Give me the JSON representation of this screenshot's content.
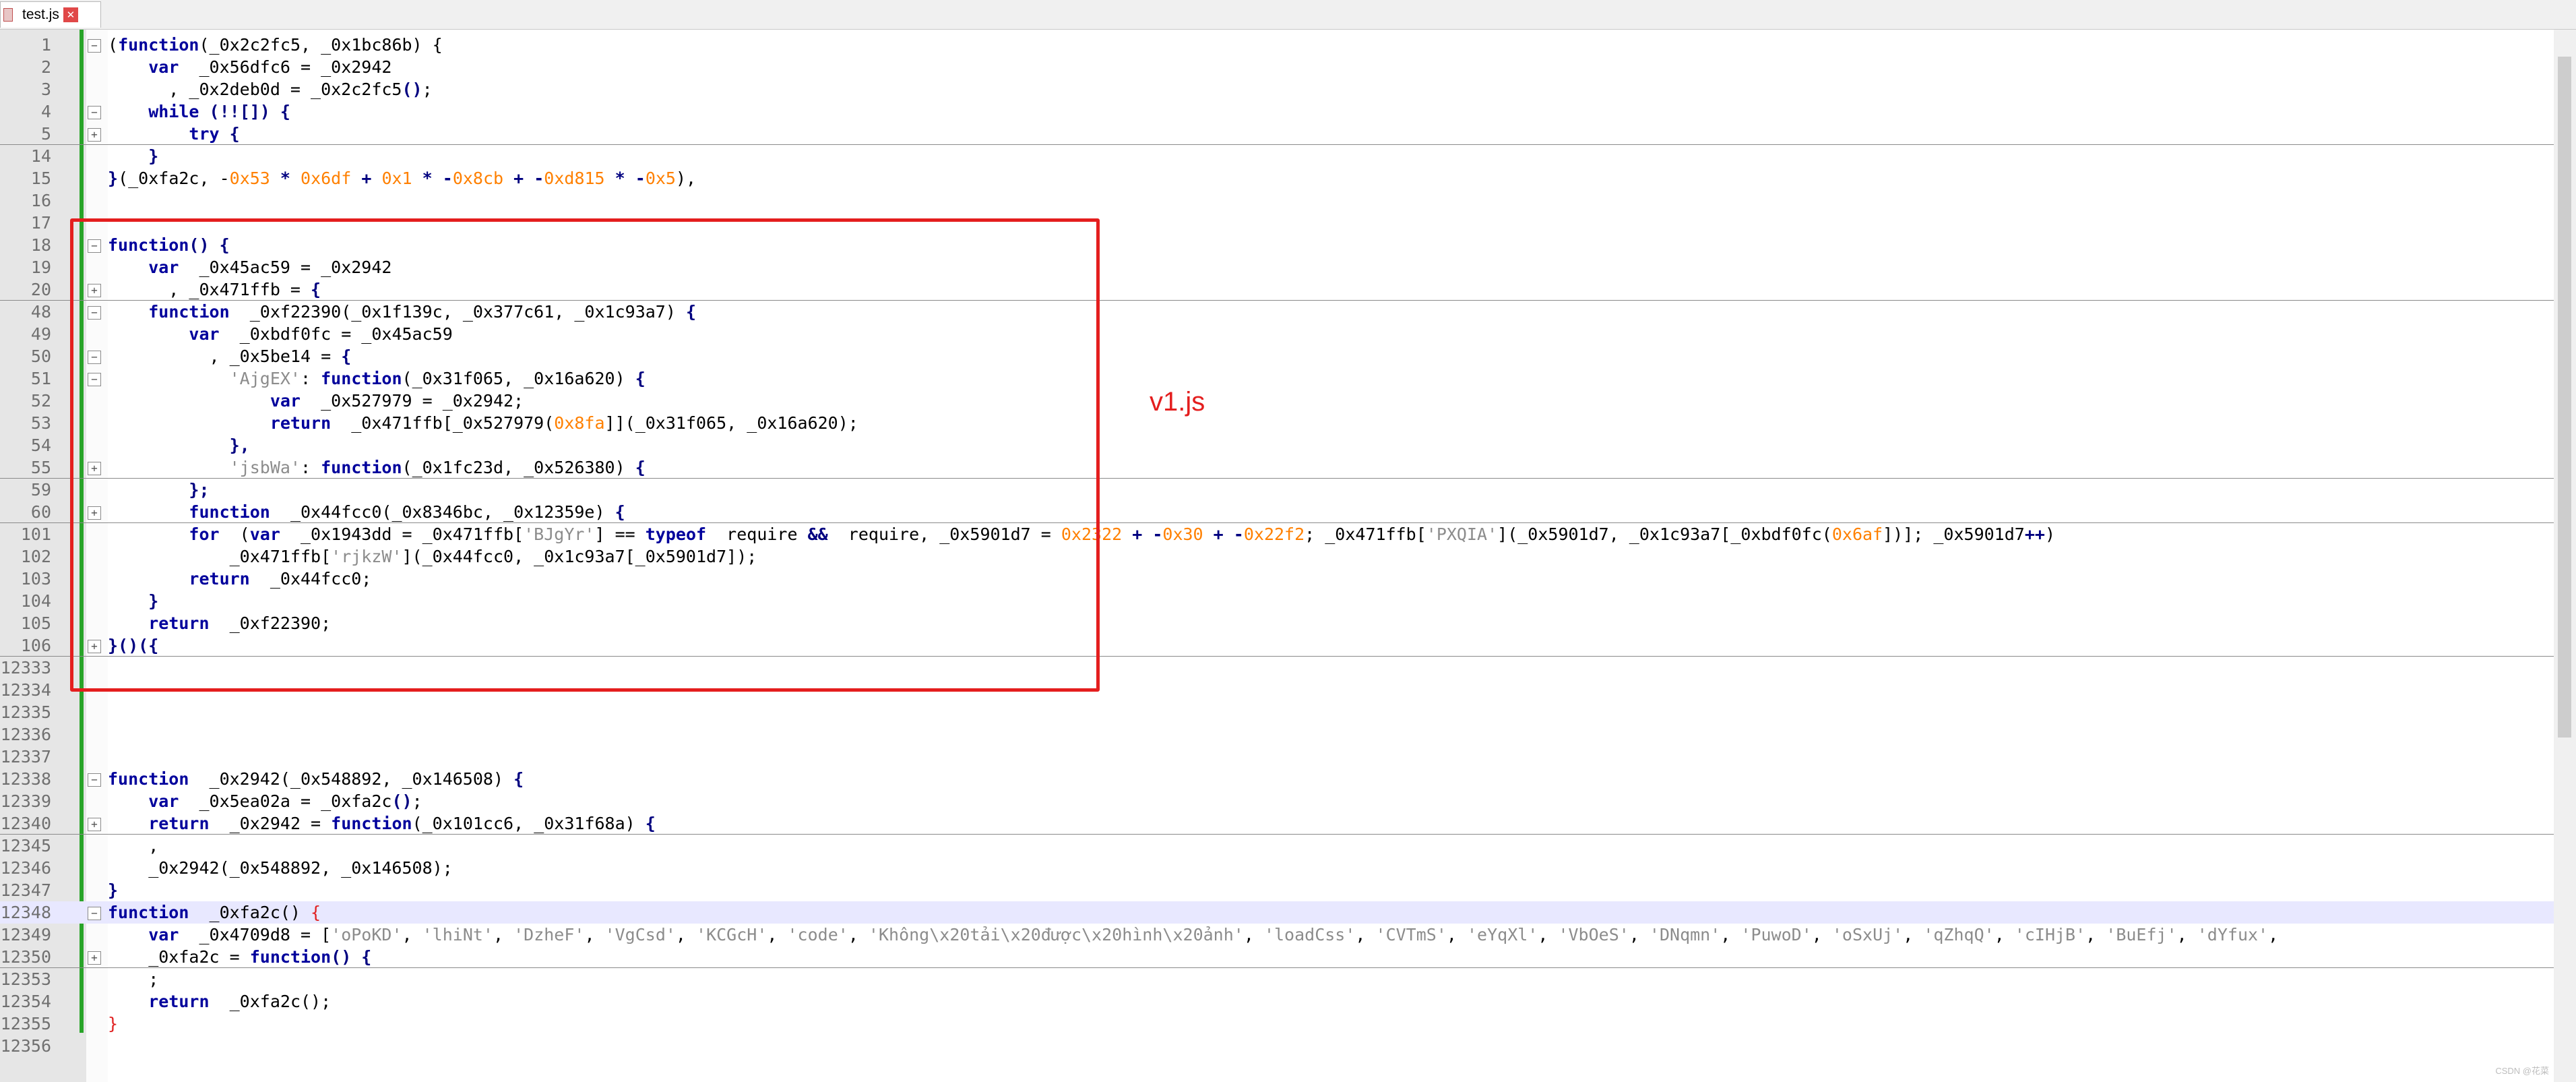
{
  "tab": {
    "filename": "test.js",
    "close_glyph": "✕"
  },
  "annotation": {
    "label": "v1.js",
    "color": "#e41e1e"
  },
  "watermark": "CSDN @花菜",
  "lines": [
    {
      "num": "1",
      "fold": "minus",
      "tokens": [
        [
          "",
          "(",
          ""
        ],
        [
          "kw",
          "function",
          ""
        ],
        [
          "",
          "(_0x2c2fc5, _0x1bc86b) {",
          ""
        ]
      ]
    },
    {
      "num": "2",
      "tokens": [
        [
          "",
          "    ",
          ""
        ],
        [
          "kw",
          "var",
          ""
        ],
        [
          "",
          "  _0x56dfc6 = _0x2942",
          ""
        ]
      ]
    },
    {
      "num": "3",
      "tokens": [
        [
          "",
          "      , _0x2deb0d = _0x2c2fc5",
          ""
        ],
        [
          "op",
          "()",
          ""
        ],
        [
          "",
          ";",
          ""
        ]
      ]
    },
    {
      "num": "4",
      "fold": "minus",
      "tokens": [
        [
          "",
          "    ",
          ""
        ],
        [
          "kw",
          "while",
          ""
        ],
        [
          "op",
          " (!![]) {",
          ""
        ]
      ]
    },
    {
      "num": "5",
      "fold": "plus",
      "sep": true,
      "tokens": [
        [
          "",
          "        ",
          ""
        ],
        [
          "kw",
          "try",
          ""
        ],
        [
          "op",
          " {",
          ""
        ]
      ]
    },
    {
      "num": "14",
      "tokens": [
        [
          "op",
          "    }",
          ""
        ]
      ]
    },
    {
      "num": "15",
      "tokens": [
        [
          "op",
          "}",
          ""
        ],
        [
          "",
          "(_0xfa2c, -",
          ""
        ],
        [
          "num",
          "0x53",
          ""
        ],
        [
          "op",
          " * ",
          ""
        ],
        [
          "num",
          "0x6df",
          ""
        ],
        [
          "op",
          " + ",
          ""
        ],
        [
          "num",
          "0x1",
          ""
        ],
        [
          "op",
          " * -",
          ""
        ],
        [
          "num",
          "0x8cb",
          ""
        ],
        [
          "op",
          " + -",
          ""
        ],
        [
          "num",
          "0xd815",
          ""
        ],
        [
          "op",
          " * -",
          ""
        ],
        [
          "num",
          "0x5",
          ""
        ],
        [
          "",
          "),",
          ""
        ]
      ]
    },
    {
      "num": "16",
      "tokens": []
    },
    {
      "num": "17",
      "tokens": []
    },
    {
      "num": "18",
      "fold": "minus",
      "tokens": [
        [
          "kw",
          "function",
          ""
        ],
        [
          "op",
          "() {",
          ""
        ]
      ]
    },
    {
      "num": "19",
      "tokens": [
        [
          "",
          "    ",
          ""
        ],
        [
          "kw",
          "var",
          ""
        ],
        [
          "",
          "  _0x45ac59 = _0x2942",
          ""
        ]
      ]
    },
    {
      "num": "20",
      "fold": "plus",
      "sep": true,
      "tokens": [
        [
          "",
          "      , _0x471ffb = ",
          ""
        ],
        [
          "op",
          "{",
          ""
        ]
      ]
    },
    {
      "num": "48",
      "fold": "minus",
      "tokens": [
        [
          "",
          "    ",
          ""
        ],
        [
          "kw",
          "function",
          ""
        ],
        [
          "",
          "  _0xf22390(_0x1f139c, _0x377c61, _0x1c93a7) ",
          ""
        ],
        [
          "op",
          "{",
          ""
        ]
      ]
    },
    {
      "num": "49",
      "tokens": [
        [
          "",
          "        ",
          ""
        ],
        [
          "kw",
          "var",
          ""
        ],
        [
          "",
          "  _0xbdf0fc = _0x45ac59",
          ""
        ]
      ]
    },
    {
      "num": "50",
      "fold": "minus",
      "tokens": [
        [
          "",
          "          , _0x5be14 = ",
          ""
        ],
        [
          "op",
          "{",
          ""
        ]
      ]
    },
    {
      "num": "51",
      "fold": "minus",
      "tokens": [
        [
          "",
          "            ",
          ""
        ],
        [
          "str",
          "'AjgEX'",
          ""
        ],
        [
          "",
          ": ",
          ""
        ],
        [
          "kw",
          "function",
          ""
        ],
        [
          "",
          "(_0x31f065, _0x16a620) ",
          ""
        ],
        [
          "op",
          "{",
          ""
        ]
      ]
    },
    {
      "num": "52",
      "tokens": [
        [
          "",
          "                ",
          ""
        ],
        [
          "kw",
          "var",
          ""
        ],
        [
          "",
          "  _0x527979 = _0x2942;",
          ""
        ]
      ]
    },
    {
      "num": "53",
      "tokens": [
        [
          "",
          "                ",
          ""
        ],
        [
          "kw",
          "return",
          ""
        ],
        [
          "",
          "  _0x471ffb[_0x527979(",
          ""
        ],
        [
          "num",
          "0x8fa",
          ""
        ],
        [
          "",
          "]](_0x31f065, _0x16a620);",
          ""
        ]
      ]
    },
    {
      "num": "54",
      "tokens": [
        [
          "op",
          "            },",
          ""
        ]
      ]
    },
    {
      "num": "55",
      "fold": "plus",
      "sep": true,
      "tokens": [
        [
          "",
          "            ",
          ""
        ],
        [
          "str",
          "'jsbWa'",
          ""
        ],
        [
          "",
          ": ",
          ""
        ],
        [
          "kw",
          "function",
          ""
        ],
        [
          "",
          "(_0x1fc23d, _0x526380) ",
          ""
        ],
        [
          "op",
          "{",
          ""
        ]
      ]
    },
    {
      "num": "59",
      "tokens": [
        [
          "op",
          "        };",
          ""
        ]
      ]
    },
    {
      "num": "60",
      "fold": "plus",
      "sep": true,
      "tokens": [
        [
          "",
          "        ",
          ""
        ],
        [
          "kw",
          "function",
          ""
        ],
        [
          "",
          "  _0x44fcc0(_0x8346bc, _0x12359e) ",
          ""
        ],
        [
          "op",
          "{",
          ""
        ]
      ]
    },
    {
      "num": "101",
      "tokens": [
        [
          "",
          "        ",
          ""
        ],
        [
          "kw",
          "for",
          ""
        ],
        [
          "",
          "  (",
          ""
        ],
        [
          "kw",
          "var",
          ""
        ],
        [
          "",
          "  _0x1943dd = _0x471ffb[",
          ""
        ],
        [
          "str",
          "'BJgYr'",
          ""
        ],
        [
          "",
          "] == ",
          ""
        ],
        [
          "kw",
          "typeof",
          ""
        ],
        [
          "",
          "  require ",
          ""
        ],
        [
          "op",
          "&&",
          ""
        ],
        [
          "",
          "  require, _0x5901d7 = ",
          ""
        ],
        [
          "num",
          "0x2322",
          ""
        ],
        [
          "op",
          " + -",
          ""
        ],
        [
          "num",
          "0x30",
          ""
        ],
        [
          "op",
          " + -",
          ""
        ],
        [
          "num",
          "0x22f2",
          ""
        ],
        [
          "",
          "; _0x471ffb[",
          ""
        ],
        [
          "str",
          "'PXQIA'",
          ""
        ],
        [
          "",
          "](_0x5901d7, _0x1c93a7[_0xbdf0fc(",
          ""
        ],
        [
          "num",
          "0x6af",
          ""
        ],
        [
          "",
          "])]; _0x5901d7",
          ""
        ],
        [
          "op",
          "++",
          ""
        ],
        [
          "",
          ")",
          ""
        ]
      ]
    },
    {
      "num": "102",
      "tokens": [
        [
          "",
          "            _0x471ffb[",
          ""
        ],
        [
          "str",
          "'rjkzW'",
          ""
        ],
        [
          "",
          "](_0x44fcc0, _0x1c93a7[_0x5901d7]);",
          ""
        ]
      ]
    },
    {
      "num": "103",
      "tokens": [
        [
          "",
          "        ",
          ""
        ],
        [
          "kw",
          "return",
          ""
        ],
        [
          "",
          "  _0x44fcc0;",
          ""
        ]
      ]
    },
    {
      "num": "104",
      "tokens": [
        [
          "op",
          "    }",
          ""
        ]
      ]
    },
    {
      "num": "105",
      "tokens": [
        [
          "",
          "    ",
          ""
        ],
        [
          "kw",
          "return",
          ""
        ],
        [
          "",
          "  _0xf22390;",
          ""
        ]
      ]
    },
    {
      "num": "106",
      "fold": "plus",
      "sep": true,
      "tokens": [
        [
          "op",
          "}()({",
          ""
        ]
      ]
    },
    {
      "num": "12333",
      "tokens": []
    },
    {
      "num": "12334",
      "tokens": []
    },
    {
      "num": "12335",
      "tokens": []
    },
    {
      "num": "12336",
      "tokens": []
    },
    {
      "num": "12337",
      "tokens": []
    },
    {
      "num": "12338",
      "fold": "minus",
      "tokens": [
        [
          "kw",
          "function",
          ""
        ],
        [
          "",
          "  _0x2942(_0x548892, _0x146508) ",
          ""
        ],
        [
          "op",
          "{",
          ""
        ]
      ]
    },
    {
      "num": "12339",
      "tokens": [
        [
          "",
          "    ",
          ""
        ],
        [
          "kw",
          "var",
          ""
        ],
        [
          "",
          "  _0x5ea02a = _0xfa2c",
          ""
        ],
        [
          "op",
          "()",
          ""
        ],
        [
          "",
          ";",
          ""
        ]
      ]
    },
    {
      "num": "12340",
      "fold": "plus",
      "sep": true,
      "tokens": [
        [
          "",
          "    ",
          ""
        ],
        [
          "kw",
          "return",
          ""
        ],
        [
          "",
          "  _0x2942 = ",
          ""
        ],
        [
          "kw",
          "function",
          ""
        ],
        [
          "",
          "(_0x101cc6, _0x31f68a) ",
          ""
        ],
        [
          "op",
          "{",
          ""
        ]
      ]
    },
    {
      "num": "12345",
      "tokens": [
        [
          "",
          "    ,",
          ""
        ]
      ]
    },
    {
      "num": "12346",
      "tokens": [
        [
          "",
          "    _0x2942(_0x548892, _0x146508);",
          ""
        ]
      ]
    },
    {
      "num": "12347",
      "tokens": [
        [
          "op",
          "}",
          ""
        ]
      ]
    },
    {
      "num": "12348",
      "fold": "minus",
      "hl": true,
      "tokens": [
        [
          "kw",
          "function",
          ""
        ],
        [
          "",
          "  _0xfa2c() ",
          ""
        ],
        [
          "red",
          "{",
          ""
        ]
      ]
    },
    {
      "num": "12349",
      "tokens": [
        [
          "",
          "    ",
          ""
        ],
        [
          "kw",
          "var",
          ""
        ],
        [
          "",
          "  _0x4709d8 = [",
          ""
        ],
        [
          "str",
          "'oPoKD'",
          ""
        ],
        [
          "",
          ", ",
          ""
        ],
        [
          "str",
          "'lhiNt'",
          ""
        ],
        [
          "",
          ", ",
          ""
        ],
        [
          "str",
          "'DzheF'",
          ""
        ],
        [
          "",
          ", ",
          ""
        ],
        [
          "str",
          "'VgCsd'",
          ""
        ],
        [
          "",
          ", ",
          ""
        ],
        [
          "str",
          "'KCGcH'",
          ""
        ],
        [
          "",
          ", ",
          ""
        ],
        [
          "str",
          "'code'",
          ""
        ],
        [
          "",
          ", ",
          ""
        ],
        [
          "str",
          "'Không\\x20tải\\x20được\\x20hình\\x20ảnh'",
          ""
        ],
        [
          "",
          ", ",
          ""
        ],
        [
          "str",
          "'loadCss'",
          ""
        ],
        [
          "",
          ", ",
          ""
        ],
        [
          "str",
          "'CVTmS'",
          ""
        ],
        [
          "",
          ", ",
          ""
        ],
        [
          "str",
          "'eYqXl'",
          ""
        ],
        [
          "",
          ", ",
          ""
        ],
        [
          "str",
          "'VbOeS'",
          ""
        ],
        [
          "",
          ", ",
          ""
        ],
        [
          "str",
          "'DNqmn'",
          ""
        ],
        [
          "",
          ", ",
          ""
        ],
        [
          "str",
          "'PuwoD'",
          ""
        ],
        [
          "",
          ", ",
          ""
        ],
        [
          "str",
          "'oSxUj'",
          ""
        ],
        [
          "",
          ", ",
          ""
        ],
        [
          "str",
          "'qZhqQ'",
          ""
        ],
        [
          "",
          ", ",
          ""
        ],
        [
          "str",
          "'cIHjB'",
          ""
        ],
        [
          "",
          ", ",
          ""
        ],
        [
          "str",
          "'BuEfj'",
          ""
        ],
        [
          "",
          ", ",
          ""
        ],
        [
          "str",
          "'dYfux'",
          ""
        ],
        [
          "",
          ",",
          ""
        ]
      ]
    },
    {
      "num": "12350",
      "fold": "plus",
      "sep": true,
      "tokens": [
        [
          "",
          "    _0xfa2c = ",
          ""
        ],
        [
          "kw",
          "function",
          ""
        ],
        [
          "op",
          "() {",
          ""
        ]
      ]
    },
    {
      "num": "12353",
      "tokens": [
        [
          "",
          "    ;",
          ""
        ]
      ]
    },
    {
      "num": "12354",
      "tokens": [
        [
          "",
          "    ",
          ""
        ],
        [
          "kw",
          "return",
          ""
        ],
        [
          "",
          "  _0xfa2c();",
          ""
        ]
      ]
    },
    {
      "num": "12355",
      "tokens": [
        [
          "red",
          "}",
          ""
        ]
      ]
    },
    {
      "num": "12356",
      "tokens": []
    }
  ]
}
